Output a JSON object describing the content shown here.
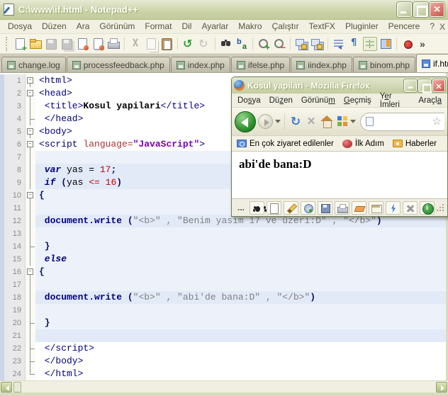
{
  "npp": {
    "title": "C:\\www\\if.html - Notepad++",
    "menu": [
      "Dosya",
      "Düzen",
      "Ara",
      "Görünüm",
      "Format",
      "Dil",
      "Ayarlar",
      "Makro",
      "Çalıştır",
      "TextFX",
      "Pluginler",
      "Pencere",
      "?"
    ],
    "menu_close": "X",
    "toolbar": [
      {
        "name": "new-file-icon"
      },
      {
        "name": "open-file-icon"
      },
      {
        "name": "save-icon",
        "disabled": true
      },
      {
        "name": "save-all-icon",
        "disabled": true
      },
      {
        "name": "close-icon"
      },
      {
        "name": "close-all-icon"
      },
      {
        "name": "print-icon"
      },
      {
        "sep": true
      },
      {
        "name": "cut-icon",
        "disabled": true
      },
      {
        "name": "copy-icon",
        "disabled": true
      },
      {
        "name": "paste-icon"
      },
      {
        "sep": true
      },
      {
        "name": "undo-icon"
      },
      {
        "name": "redo-icon",
        "disabled": true
      },
      {
        "sep": true
      },
      {
        "name": "find-icon"
      },
      {
        "name": "replace-icon"
      },
      {
        "sep": true
      },
      {
        "name": "zoom-in-icon"
      },
      {
        "name": "zoom-out-icon"
      },
      {
        "sep": true
      },
      {
        "name": "sync-vertical-icon"
      },
      {
        "name": "sync-horizontal-icon"
      },
      {
        "sep": true
      },
      {
        "name": "word-wrap-icon"
      },
      {
        "name": "show-symbols-icon"
      },
      {
        "name": "indent-guide-icon",
        "pressed": true
      },
      {
        "name": "doc-map-icon"
      },
      {
        "sep": true
      },
      {
        "name": "record-macro-icon"
      }
    ],
    "toolbar_overflow": "»",
    "tabs": [
      {
        "label": "change.log"
      },
      {
        "label": "processfeedback.php"
      },
      {
        "label": "index.php"
      },
      {
        "label": "ifelse.php"
      },
      {
        "label": "iindex.php"
      },
      {
        "label": "binom.php"
      },
      {
        "label": "if.html",
        "active": true
      }
    ],
    "editor": {
      "lines": [
        {
          "n": 1,
          "fold": "box",
          "bg": "plain",
          "tokens": [
            [
              "tag",
              "<html>"
            ]
          ]
        },
        {
          "n": 2,
          "fold": "box",
          "bg": "plain",
          "tokens": [
            [
              "tag",
              "<head>"
            ]
          ]
        },
        {
          "n": 3,
          "fold": "pipe",
          "bg": "plain",
          "tokens": [
            [
              "tag",
              " <title>"
            ],
            [
              "bold",
              "Kosul yapilari"
            ],
            [
              "tag",
              "</title>"
            ]
          ]
        },
        {
          "n": 4,
          "fold": "corner",
          "bg": "plain",
          "tokens": [
            [
              "tag",
              " </head>"
            ]
          ]
        },
        {
          "n": 5,
          "fold": "box",
          "bg": "plain",
          "tokens": [
            [
              "tag",
              "<body>"
            ]
          ]
        },
        {
          "n": 6,
          "fold": "box",
          "bg": "plain",
          "tokens": [
            [
              "tag",
              "<script "
            ],
            [
              "attr",
              "language="
            ],
            [
              "value",
              "\"JavaScript\""
            ],
            [
              "tag",
              ">"
            ]
          ]
        },
        {
          "n": 7,
          "fold": "pipe",
          "bg": "js",
          "tokens": []
        },
        {
          "n": 8,
          "fold": "pipe",
          "bg": "js2",
          "tokens": [
            [
              "kw",
              " var"
            ],
            [
              "id",
              " yas = "
            ],
            [
              "num",
              "17"
            ],
            [
              "punct",
              ";"
            ]
          ]
        },
        {
          "n": 9,
          "fold": "pipe",
          "bg": "js2",
          "tokens": [
            [
              "kw",
              " if"
            ],
            [
              "paren",
              " ("
            ],
            [
              "id",
              "yas "
            ],
            [
              "num",
              "<= 16"
            ],
            [
              "paren",
              ")"
            ]
          ]
        },
        {
          "n": 10,
          "fold": "box",
          "bg": "js",
          "tokens": [
            [
              "paren",
              "{"
            ]
          ]
        },
        {
          "n": 11,
          "fold": "pipe",
          "bg": "js",
          "tokens": []
        },
        {
          "n": 12,
          "fold": "pipe",
          "bg": "js2",
          "tokens": [
            [
              "kw2",
              " document.write"
            ],
            [
              "paren",
              " ("
            ],
            [
              "str",
              "\"<b>\" , \"Benim yasım 17 ve üzeri:D\" , \"</b>\""
            ],
            [
              "paren",
              ")"
            ]
          ]
        },
        {
          "n": 13,
          "fold": "pipe",
          "bg": "js",
          "tokens": []
        },
        {
          "n": 14,
          "fold": "corner",
          "bg": "js",
          "tokens": [
            [
              "paren",
              " }"
            ]
          ]
        },
        {
          "n": 15,
          "fold": "pipe",
          "bg": "js",
          "tokens": [
            [
              "kw",
              " else"
            ]
          ]
        },
        {
          "n": 16,
          "fold": "box",
          "bg": "js",
          "tokens": [
            [
              "paren",
              "{"
            ]
          ]
        },
        {
          "n": 17,
          "fold": "pipe",
          "bg": "js",
          "tokens": []
        },
        {
          "n": 18,
          "fold": "pipe",
          "bg": "js2",
          "tokens": [
            [
              "kw2",
              " document.write"
            ],
            [
              "paren",
              " ("
            ],
            [
              "str",
              "\"<b>\" , \"abi'de bana:D\" , \"</b>\""
            ],
            [
              "paren",
              ")"
            ]
          ]
        },
        {
          "n": 19,
          "fold": "pipe",
          "bg": "js",
          "tokens": []
        },
        {
          "n": 20,
          "fold": "corner",
          "bg": "js",
          "tokens": [
            [
              "paren",
              " }"
            ]
          ]
        },
        {
          "n": 21,
          "fold": "pipe",
          "bg": "js2",
          "tokens": []
        },
        {
          "n": 22,
          "fold": "corner",
          "bg": "plain",
          "tokens": [
            [
              "tag",
              " </script>"
            ]
          ]
        },
        {
          "n": 23,
          "fold": "corner",
          "bg": "plain",
          "tokens": [
            [
              "tag",
              " </body>"
            ]
          ]
        },
        {
          "n": 24,
          "fold": "end",
          "bg": "plain",
          "tokens": [
            [
              "tag",
              " </html>"
            ]
          ]
        }
      ]
    }
  },
  "firefox": {
    "title": "Kosul yapilari - Mozilla Firefox",
    "menu": [
      {
        "label": "Dosya",
        "u": 2
      },
      {
        "label": "Düzen",
        "u": 2
      },
      {
        "label": "Görünüm",
        "u": 6
      },
      {
        "label": "Geçmiş",
        "u": 0
      },
      {
        "label": "Yer İmleri",
        "u": 1
      },
      {
        "label": "Araçla",
        "u": 5
      }
    ],
    "bookmarks": [
      {
        "label": "En çok ziyaret edilenler",
        "icon": "b-folder-search-icon"
      },
      {
        "label": "İlk Adım",
        "icon": "b-firstrun-icon"
      },
      {
        "label": "Haberler",
        "icon": "b-rss-folder-icon"
      }
    ],
    "content_text": "abi'de bana:D",
    "statusbar": {
      "ellipsis": "...",
      "icons": [
        "bug-icon",
        "new-page-icon",
        "pencil-icon",
        "globe-icon",
        "save-icon",
        "print-icon",
        "eraser-icon",
        "window-icon",
        "lightning-icon",
        "tools-icon",
        "info-icon"
      ]
    }
  }
}
